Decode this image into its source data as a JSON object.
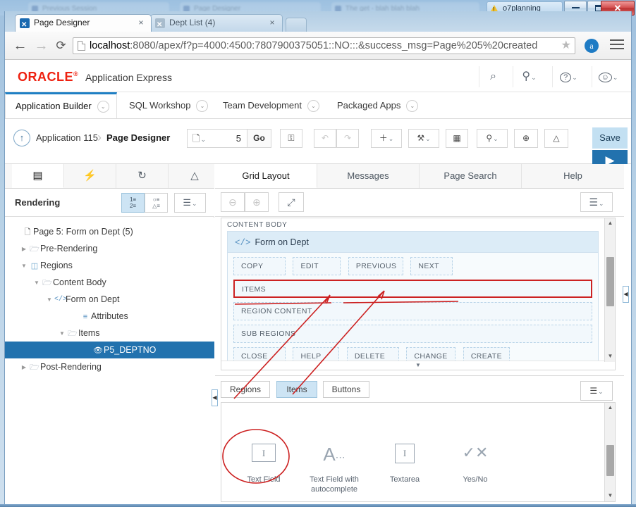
{
  "os": {
    "process_label": "o7planning",
    "warning_icon": "warning-triangle-icon",
    "minimize": "–",
    "maximize": "☐",
    "close": "✕",
    "background_tabs": [
      "Previous Session",
      "Page Designer",
      "The get - blah blah blah"
    ]
  },
  "browser": {
    "tabs": [
      {
        "title": "Page Designer",
        "active": true,
        "close": "×"
      },
      {
        "title": "Dept List (4)",
        "active": false,
        "close": "×"
      }
    ],
    "nav": {
      "back": "←",
      "forward": "→",
      "reload": "⟳"
    },
    "url": {
      "host": "localhost",
      "rest": ":8080/apex/f?p=4000:4500:7807900375051::NO:::&success_msg=Page%205%20created",
      "full": "localhost:8080/apex/f?p=4000:4500:7807900375051::NO:::&success_msg=Page%205%20created",
      "page_icon": "page-icon",
      "bookmark_star": "★"
    },
    "extension_label": "a",
    "menu_icon": "hamburger-menu-icon"
  },
  "apex": {
    "logo": "ORACLE",
    "logo_mark": "®",
    "product": "Application Express",
    "header_icons": [
      {
        "name": "search-icon",
        "glyph": "⌕"
      },
      {
        "name": "admin-user-icon",
        "glyph": "⚲",
        "caret": "⌄"
      },
      {
        "name": "help-icon",
        "glyph": "?",
        "caret": "⌄"
      },
      {
        "name": "account-icon",
        "glyph": "☺",
        "caret": "⌄"
      }
    ],
    "nav_tabs": [
      {
        "label": "Application Builder",
        "selected": true,
        "caret": "⌄"
      },
      {
        "label": "SQL Workshop",
        "selected": false,
        "caret": "⌄"
      },
      {
        "label": "Team Development",
        "selected": false,
        "caret": "⌄"
      },
      {
        "label": "Packaged Apps",
        "selected": false,
        "caret": "⌄"
      }
    ],
    "toolbar": {
      "up_icon": "↑",
      "breadcrumb": [
        "Application 115",
        "Page Designer"
      ],
      "breadcrumb_sep": "›",
      "page_selector": {
        "icon": "page-icon",
        "caret": "⌄",
        "value": "5",
        "go_label": "Go"
      },
      "buttons": [
        {
          "name": "lock-button",
          "glyph": "⚿",
          "dim": false
        },
        {
          "name": "undo-button",
          "glyph": "↶",
          "dim": true
        },
        {
          "name": "redo-button",
          "glyph": "↷",
          "dim": true
        },
        {
          "name": "create-button",
          "glyph": "＋",
          "caret": "⌄",
          "dim": false
        },
        {
          "name": "utilities-button",
          "glyph": "⚒",
          "caret": "⌄",
          "dim": false
        },
        {
          "name": "page-layout-button",
          "glyph": "▦",
          "dim": false
        },
        {
          "name": "shared-components-button",
          "glyph": "⚲",
          "caret": "⌄",
          "dim": false
        },
        {
          "name": "comments-button",
          "glyph": "⊕",
          "dim": false
        },
        {
          "name": "theme-button",
          "glyph": "△",
          "dim": false
        }
      ],
      "save_label": "Save",
      "run_icon": "▶"
    }
  },
  "left_panel": {
    "tabs": [
      {
        "name": "rendering-tab",
        "glyph": "▤",
        "selected": true
      },
      {
        "name": "dynamic-actions-tab",
        "glyph": "⚡",
        "selected": false
      },
      {
        "name": "processing-tab",
        "glyph": "↻",
        "selected": false
      },
      {
        "name": "page-shared-components-tab",
        "glyph": "△",
        "selected": false
      }
    ],
    "title": "Rendering",
    "view_buttons": [
      {
        "name": "tree-view-button",
        "label": "1≡\n2≡",
        "selected": true
      },
      {
        "name": "component-view-button",
        "label": "○≡\n△≡",
        "selected": false
      },
      {
        "name": "panel-menu-button",
        "label": "☰",
        "caret": "⌄",
        "selected": false
      }
    ],
    "tree": [
      {
        "label": "Page 5: Form on Dept (5)",
        "indent": 0,
        "twisty": "",
        "icon": "page-icon",
        "selected": false
      },
      {
        "label": "Pre-Rendering",
        "indent": 1,
        "twisty": "▶",
        "icon": "folder-icon",
        "selected": false
      },
      {
        "label": "Regions",
        "indent": 1,
        "twisty": "▼",
        "icon": "region-icon",
        "selected": false
      },
      {
        "label": "Content Body",
        "indent": 2,
        "twisty": "▼",
        "icon": "open-folder-icon",
        "selected": false
      },
      {
        "label": "Form on Dept",
        "indent": 3,
        "twisty": "▼",
        "icon": "code-icon",
        "selected": false
      },
      {
        "label": "Attributes",
        "indent": 4,
        "twisty": "",
        "icon": "attributes-icon",
        "selected": false
      },
      {
        "label": "Items",
        "indent": 4,
        "twisty": "▼",
        "icon": "open-folder-icon",
        "selected": false
      },
      {
        "label": "P5_DEPTNO",
        "indent": 5,
        "twisty": "",
        "icon": "hidden-item-icon",
        "selected": true
      },
      {
        "label": "Post-Rendering",
        "indent": 1,
        "twisty": "▶",
        "icon": "folder-icon",
        "selected": false
      }
    ],
    "collapse_handle": "◀"
  },
  "main_panel": {
    "tabs": [
      {
        "label": "Grid Layout",
        "selected": true
      },
      {
        "label": "Messages",
        "selected": false
      },
      {
        "label": "Page Search",
        "selected": false
      },
      {
        "label": "Help",
        "selected": false
      }
    ],
    "toolbar": [
      {
        "name": "zoom-out-button",
        "glyph": "⊖",
        "dim": true
      },
      {
        "name": "zoom-in-button",
        "glyph": "⊕",
        "dim": true
      },
      {
        "name": "expand-button",
        "glyph": "⤢",
        "dim": false
      },
      {
        "name": "grid-menu-button",
        "glyph": "☰",
        "caret": "⌄",
        "dim": false
      }
    ],
    "grid": {
      "section_label": "CONTENT BODY",
      "region_title": "Form on Dept",
      "region_icon": "</>",
      "button_slots": [
        "COPY",
        "EDIT",
        "PREVIOUS",
        "NEXT"
      ],
      "items_slot": "ITEMS",
      "region_content_slot": "REGION CONTENT",
      "sub_regions_slot": "SUB REGIONS",
      "bottom_slots": [
        "CLOSE",
        "HELP",
        "DELETE",
        "CHANGE",
        "CREATE"
      ],
      "expand_chevron": "▼"
    },
    "collapse_handle": "◀"
  },
  "gallery": {
    "tabs": [
      {
        "label": "Regions",
        "selected": false
      },
      {
        "label": "Items",
        "selected": true
      },
      {
        "label": "Buttons",
        "selected": false
      }
    ],
    "menu_button": {
      "name": "gallery-menu-button",
      "glyph": "☰",
      "caret": "⌄"
    },
    "items": [
      {
        "label": "Text Field",
        "icon": "text-field-icon",
        "circled": true
      },
      {
        "label": "Text Field with autocomplete",
        "icon": "autocomplete-icon",
        "circled": false
      },
      {
        "label": "Textarea",
        "icon": "textarea-icon",
        "circled": false
      },
      {
        "label": "Yes/No",
        "icon": "yes-no-icon",
        "circled": false
      }
    ]
  },
  "annotations": {
    "color": "#cc2020",
    "circle_target": "Text Field",
    "arrow_targets": [
      "ITEMS slot",
      "ITEMS slot"
    ]
  },
  "colors": {
    "accent_blue": "#2272ae",
    "tab_selected_blue": "#1f7fc4",
    "selected_row": "#2272ae",
    "save_button": "#c3e0f2",
    "annotation_red": "#cc2020",
    "oracle_red": "#ee2211"
  }
}
